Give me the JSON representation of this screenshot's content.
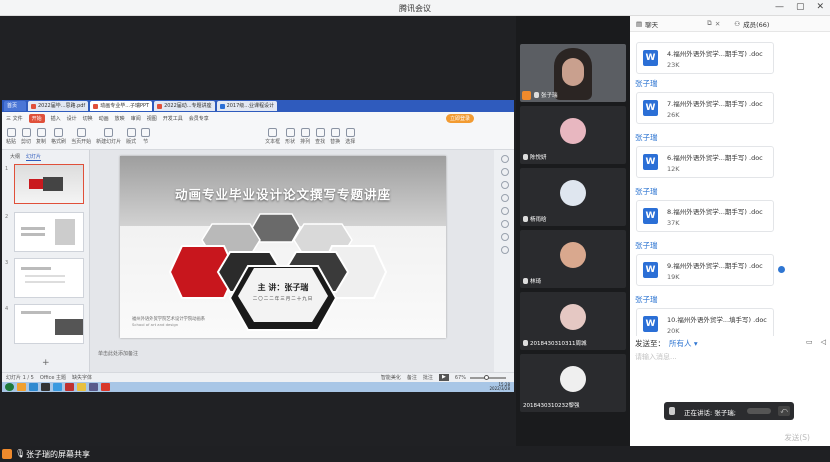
{
  "window": {
    "title": "腾讯会议",
    "min_icon": "minimize-icon",
    "max_icon": "maximize-icon",
    "close_icon": "close-icon"
  },
  "share": {
    "label": "张子瑞的屏幕共享",
    "wps": {
      "tabs": [
        "首页",
        "2022届毕...思路.pdf",
        "动画专业毕...子瑞PPT",
        "2022届动...专题讲座",
        "2017级...业课程设计"
      ],
      "menu": [
        "三 文件",
        "开始",
        "插入",
        "设计",
        "切换",
        "动画",
        "放映",
        "审阅",
        "视图",
        "开发工具",
        "会员专享"
      ],
      "active_menu": "开始",
      "toolbar": [
        "粘贴",
        "剪切",
        "复制",
        "格式刷",
        "当页开始",
        "新建幻灯片",
        "版式",
        "节",
        "文本框",
        "形状",
        "排列",
        "查找",
        "替换",
        "选择"
      ],
      "top_right_button": "立即登录",
      "thumb_tabs": [
        "大纲",
        "幻灯片"
      ],
      "thumb_nums": [
        "1",
        "2",
        "3",
        "4"
      ],
      "add_slide": "+",
      "notes": "单击此处添加备注",
      "slide": {
        "title": "动画专业毕业设计论文撰写专题讲座",
        "lecturer": "主 讲：张子瑞",
        "date": "二〇二二年三月二十九日",
        "school_zh": "福州外语外贸学院艺术设计学院动画系",
        "school_en": "School of art and design"
      },
      "status": {
        "page": "幻灯片 1 / 5",
        "theme": "Office 主题",
        "missing_font": "缺失字体",
        "beautify": "智能美化",
        "notes_btn": "备注",
        "comment": "批注",
        "zoom": "67%"
      },
      "clock": {
        "time": "15:28",
        "date": "2022/3/28"
      }
    }
  },
  "participants": [
    {
      "name": "张子瑞",
      "video": true
    },
    {
      "name": "陈悦妍",
      "avatar_color": "#e8b7c0"
    },
    {
      "name": "杨雨晗",
      "avatar_color": "#dfe6ef"
    },
    {
      "name": "林琦",
      "avatar_color": "#d9a88e"
    },
    {
      "name": "2018430310311周城",
      "avatar_color": "#e5c8c3"
    },
    {
      "name": "2018430310232黎强",
      "avatar_color": "#efefef"
    }
  ],
  "chat": {
    "tab_chat": "聊天",
    "tab_members": "成员(66)",
    "sender": "张子瑞",
    "files": [
      {
        "name": "4.福州外语外贸学...期手写) .doc",
        "size": "23K"
      },
      {
        "name": "7.福州外语外贸学...期手写) .doc",
        "size": "26K"
      },
      {
        "name": "6.福州外语外贸学...期手写) .doc",
        "size": "12K"
      },
      {
        "name": "8.福州外语外贸学...期手写) .doc",
        "size": "37K"
      },
      {
        "name": "9.福州外语外贸学...期手写) .doc",
        "size": "19K"
      },
      {
        "name": "10.福州外语外贸学...填手写) .doc",
        "size": "20K"
      }
    ],
    "send_to_label": "发送至：",
    "send_to_value": "所有人",
    "input_placeholder": "请输入消息...",
    "send_button": "发送(S)",
    "speaking_label": "正在讲话: 张子瑞;"
  }
}
